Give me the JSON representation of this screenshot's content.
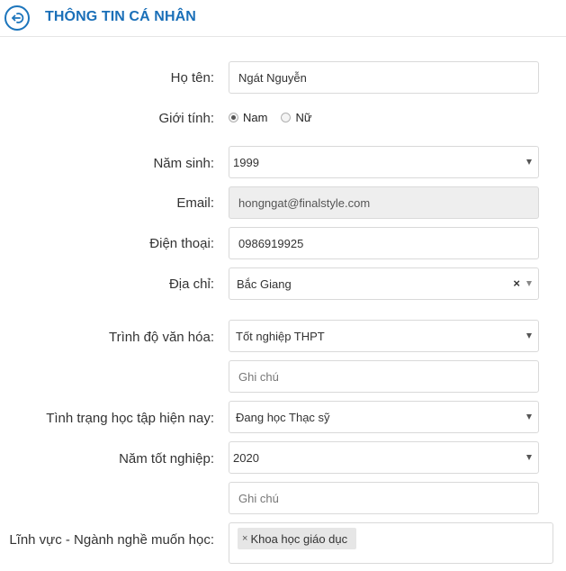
{
  "header": {
    "title": "THÔNG TIN CÁ NHÂN",
    "icon": "arrow-circle-icon",
    "accent": "#1a6fb8"
  },
  "form": {
    "name": {
      "label": "Họ tên:",
      "value": "Ngát Nguyễn"
    },
    "gender": {
      "label": "Giới tính:",
      "options": [
        "Nam",
        "Nữ"
      ],
      "selected": "Nam"
    },
    "birth_year": {
      "label": "Năm sinh:",
      "value": "1999"
    },
    "email": {
      "label": "Email:",
      "value": "hongngat@finalstyle.com"
    },
    "phone": {
      "label": "Điện thoại:",
      "value": "0986919925"
    },
    "address": {
      "label": "Địa chỉ:",
      "value": "Bắc Giang",
      "clear": "×"
    },
    "education": {
      "label": "Trình độ văn hóa:",
      "value": "Tốt nghiệp THPT",
      "note_placeholder": "Ghi chú"
    },
    "study_status": {
      "label": "Tình trạng học tập hiện nay:",
      "value": "Đang học Thạc sỹ"
    },
    "graduation_year": {
      "label": "Năm tốt nghiệp:",
      "value": "2020",
      "note_placeholder": "Ghi chú"
    },
    "field_of_study": {
      "label": "Lĩnh vực - Ngành nghề muốn học:",
      "tags": [
        {
          "remove": "×",
          "label": "Khoa học giáo dục"
        }
      ]
    }
  }
}
